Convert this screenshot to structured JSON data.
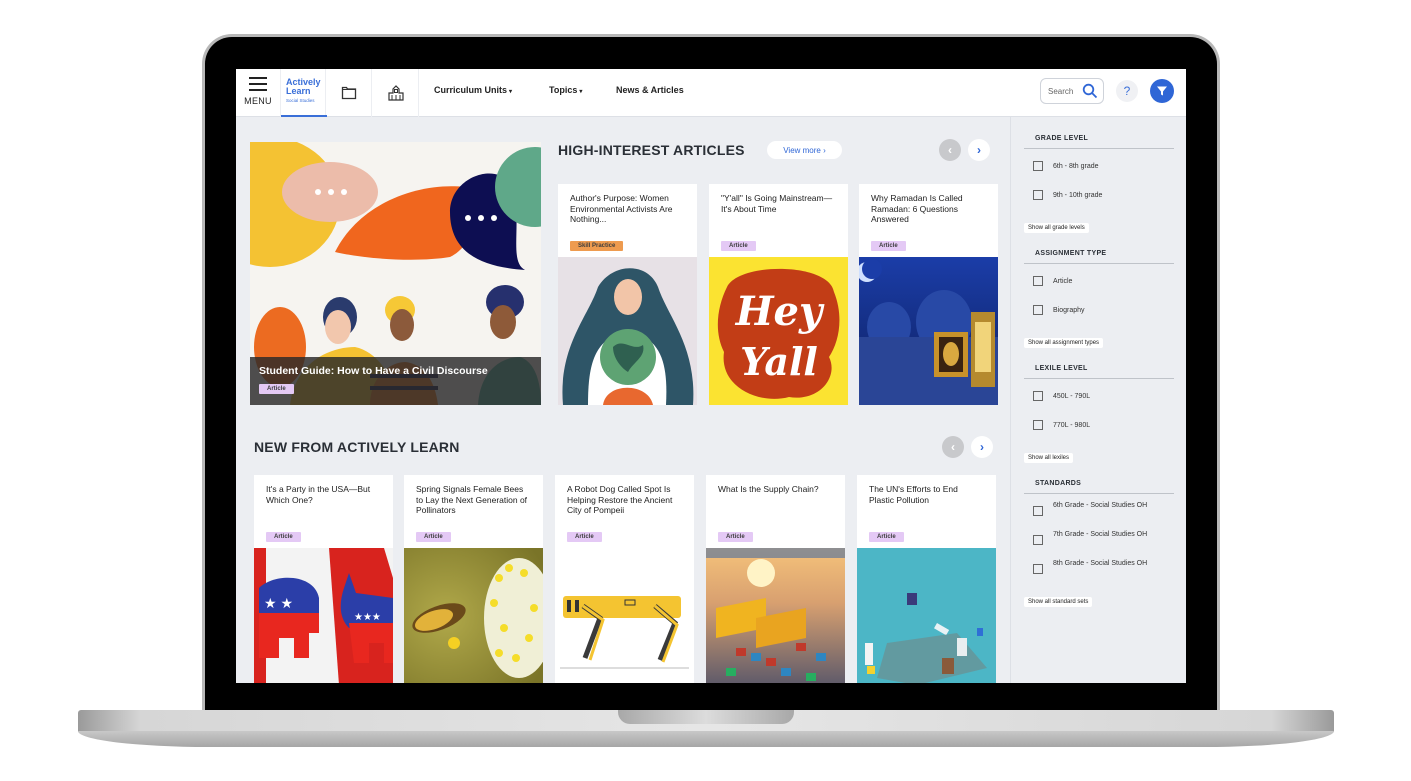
{
  "topbar": {
    "menu_label": "MENU",
    "logo_line1": "Actively",
    "logo_line2": "Learn",
    "logo_sub": "Social Studies",
    "nav": [
      {
        "label": "Curriculum Units",
        "has_caret": true
      },
      {
        "label": "Topics",
        "has_caret": true
      },
      {
        "label": "News & Articles",
        "has_caret": false
      }
    ],
    "caret": "▾",
    "search_placeholder": "Search",
    "help_label": "?"
  },
  "hero": {
    "title": "Student Guide: How to Have a Civil Discourse",
    "badge": "Article"
  },
  "high_interest": {
    "title": "HIGH-INTEREST ARTICLES",
    "view_more": "View more",
    "view_more_chevron": "›",
    "prev": "‹",
    "next": "›",
    "cards": [
      {
        "title": "Author's Purpose: Women Environmental Activists Are Nothing...",
        "badge": "Skill Practice",
        "badge_type": "skill"
      },
      {
        "title": "\"Y'all\" Is Going Mainstream—It's About Time",
        "badge": "Article",
        "badge_type": "article"
      },
      {
        "title": "Why Ramadan Is Called Ramadan: 6 Questions Answered",
        "badge": "Article",
        "badge_type": "article"
      }
    ]
  },
  "new_from": {
    "title": "NEW FROM ACTIVELY LEARN",
    "prev": "‹",
    "next": "›",
    "cards": [
      {
        "title": "It's a Party in the USA—But Which One?",
        "badge": "Article"
      },
      {
        "title": "Spring Signals Female Bees to Lay the Next Generation of Pollinators",
        "badge": "Article"
      },
      {
        "title": "A Robot Dog Called Spot Is Helping Restore the Ancient City of Pompeii",
        "badge": "Article"
      },
      {
        "title": "What Is the Supply Chain?",
        "badge": "Article"
      },
      {
        "title": "The UN's Efforts to End Plastic Pollution",
        "badge": "Article"
      }
    ]
  },
  "sidebar": {
    "groups": [
      {
        "heading": "GRADE LEVEL",
        "options": [
          "6th - 8th grade",
          "9th - 10th grade"
        ],
        "show_all": "Show all grade levels"
      },
      {
        "heading": "ASSIGNMENT TYPE",
        "options": [
          "Article",
          "Biography"
        ],
        "show_all": "Show all assignment types"
      },
      {
        "heading": "LEXILE LEVEL",
        "options": [
          "450L - 790L",
          "770L - 980L"
        ],
        "show_all": "Show all lexiles"
      },
      {
        "heading": "STANDARDS",
        "options": [
          "6th Grade - Social Studies OH",
          "7th Grade - Social Studies OH",
          "8th Grade - Social Studies OH"
        ],
        "show_all": "Show all standard sets"
      }
    ]
  },
  "colors": {
    "accent": "#2f66d6",
    "article_badge": "#e4c9f5",
    "skill_badge": "#ee9b4f",
    "background": "#eceef2"
  }
}
